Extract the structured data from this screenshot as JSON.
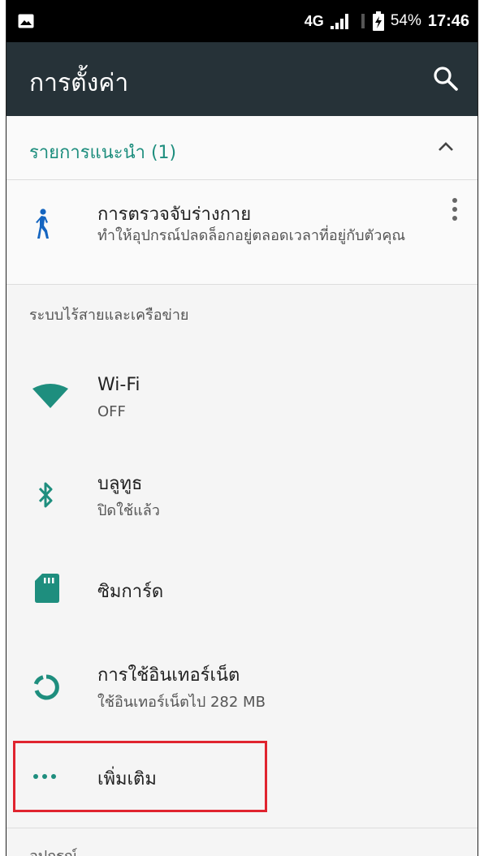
{
  "status_bar": {
    "network": "4G",
    "battery_percent": "54%",
    "time": "17:46"
  },
  "app_bar": {
    "title": "การตั้งค่า",
    "search_icon": "search-icon"
  },
  "suggestions": {
    "header": "รายการแนะนำ (1)",
    "item": {
      "title": "การตรวจจับร่างกาย",
      "subtitle": "ทำให้อุปกรณ์ปลดล็อกอยู่ตลอดเวลาที่อยู่กับตัวคุณ"
    }
  },
  "sections": [
    {
      "label": "ระบบไร้สายและเครือข่าย",
      "items": [
        {
          "title": "Wi-Fi",
          "subtitle": "OFF",
          "icon": "wifi-icon"
        },
        {
          "title": "บลูทูธ",
          "subtitle": "ปิดใช้แล้ว",
          "icon": "bluetooth-icon"
        },
        {
          "title": "ซิมการ์ด",
          "subtitle": "",
          "icon": "sim-card-icon"
        },
        {
          "title": "การใช้อินเทอร์เน็ต",
          "subtitle": "ใช้อินเทอร์เน็ตไป 282 MB",
          "icon": "data-usage-icon"
        },
        {
          "title": "เพิ่มเติม",
          "subtitle": "",
          "icon": "more-icon"
        }
      ]
    },
    {
      "label": "อุปกรณ์"
    }
  ],
  "colors": {
    "accent": "#1e8e7e",
    "app_bar": "#263238",
    "status_bar": "#000000",
    "highlight": "#e0242f"
  }
}
